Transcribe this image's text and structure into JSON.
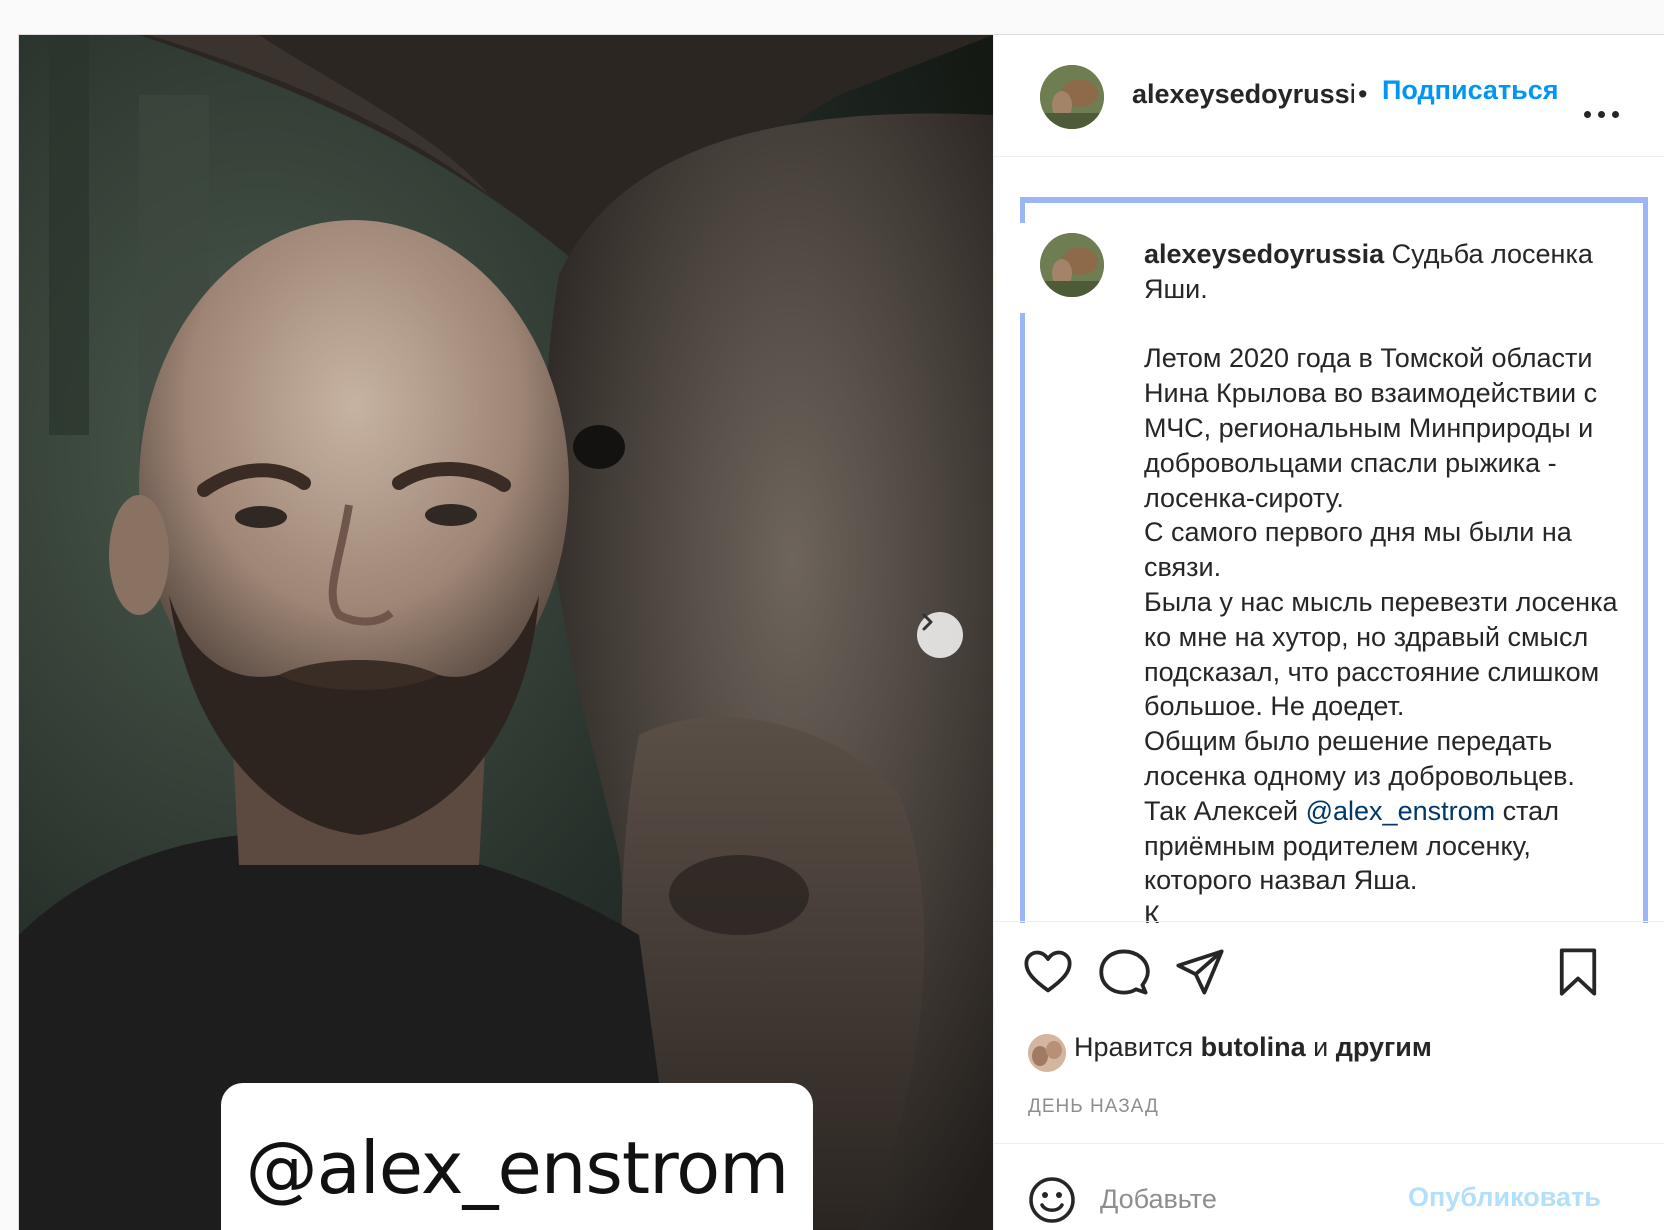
{
  "photo": {
    "tag_text": "@alex_enstrom"
  },
  "header": {
    "username": "alexeysedoyrussia",
    "separator": "•",
    "follow_label": "Подписаться"
  },
  "caption": {
    "username": "alexeysedoyrussia",
    "lines": [
      " Судьба лосенка Яши.",
      "",
      "Летом 2020 года в Томской области Нина Крылова во взаимодействии с МЧС, региональным Минприроды и добровольцами спасли рыжика - лосенка-сироту.",
      "С самого первого дня мы были на связи.",
      "Была у нас мысль перевезти лосенка ко мне на хутор, но здравый смысл подсказал, что расстояние слишком большое. Не доедет.",
      "Общим было решение передать лосенка одному из добровольцев."
    ],
    "mention_prefix": "Так Алексей ",
    "mention": "@alex_enstrom",
    "mention_suffix": " стал приёмным родителем лосенку, которого назвал Яша.",
    "cut_line": "К"
  },
  "likes": {
    "prefix": "Нравится ",
    "user": "butolina",
    "middle": " и ",
    "others": "другим"
  },
  "timestamp": "ДЕНЬ НАЗАД",
  "comment": {
    "placeholder": "Добавьте",
    "publish_label": "Опубликовать"
  },
  "colors": {
    "link_blue": "#0095f6",
    "publish_disabled": "#b2dffc",
    "mention": "#00376b",
    "focus_outline": "#9bb6f5"
  }
}
